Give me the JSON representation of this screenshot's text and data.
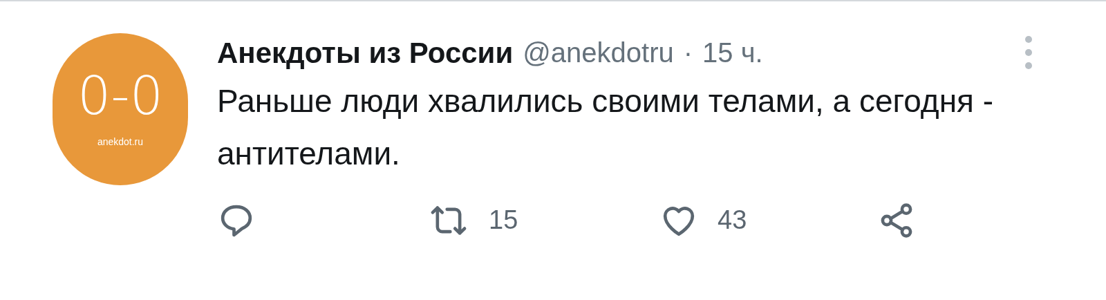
{
  "tweet": {
    "avatar": {
      "title": "0-0",
      "subtitle": "anekdot.ru"
    },
    "author": "Анекдоты из России",
    "handle": "@anekdotru",
    "separator": "·",
    "time": "15 ч.",
    "text": "Раньше люди хвалились своими телами, а сегодня - антителами.",
    "actions": [
      {
        "kind": "reply"
      },
      {
        "kind": "retweet",
        "count": "15"
      },
      {
        "kind": "like",
        "count": "43"
      },
      {
        "kind": "share"
      }
    ]
  }
}
